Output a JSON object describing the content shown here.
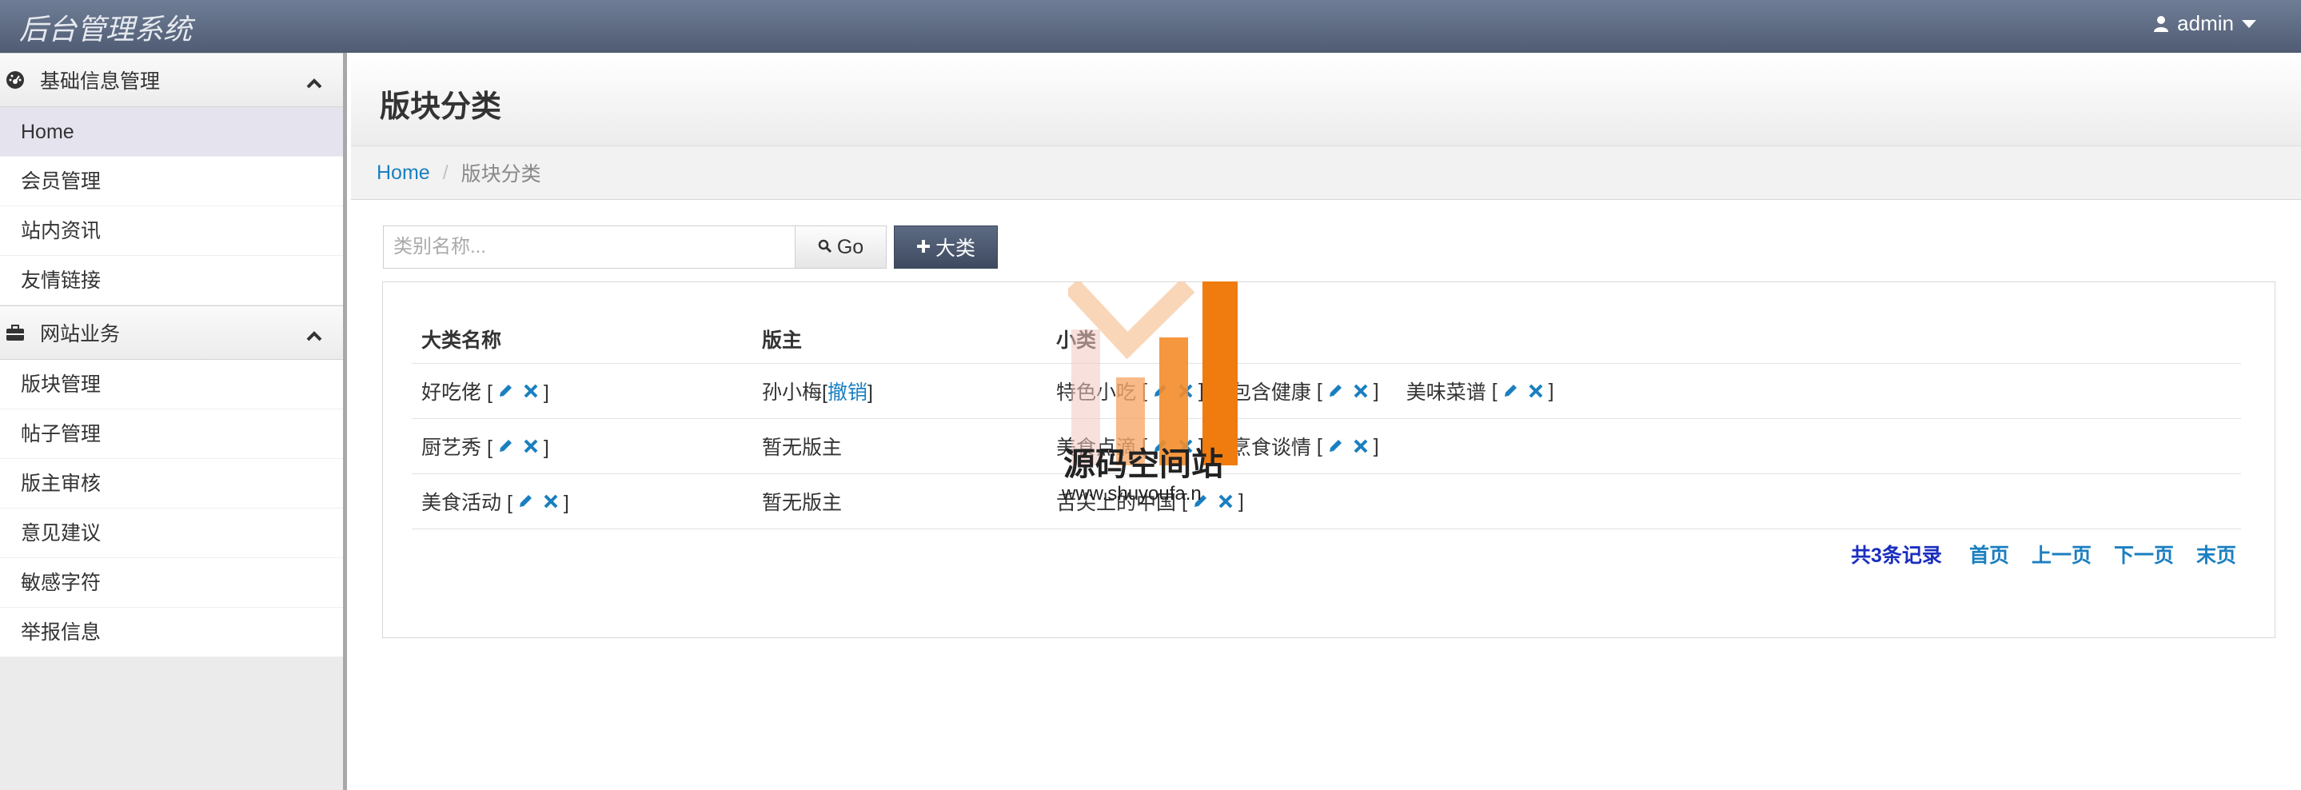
{
  "header": {
    "brand": "后台管理系统",
    "user": "admin"
  },
  "sidebar": {
    "groups": [
      {
        "title": "基础信息管理",
        "items": [
          {
            "label": "Home",
            "active": true
          },
          {
            "label": "会员管理"
          },
          {
            "label": "站内资讯"
          },
          {
            "label": "友情链接"
          }
        ]
      },
      {
        "title": "网站业务",
        "items": [
          {
            "label": "版块管理"
          },
          {
            "label": "帖子管理"
          },
          {
            "label": "版主审核"
          },
          {
            "label": "意见建议"
          },
          {
            "label": "敏感字符"
          },
          {
            "label": "举报信息"
          }
        ]
      }
    ]
  },
  "page": {
    "title": "版块分类",
    "breadcrumb": {
      "home": "Home",
      "current": "版块分类"
    }
  },
  "toolbar": {
    "search_placeholder": "类别名称...",
    "go_label": "Go",
    "add_label": "大类"
  },
  "table": {
    "headers": [
      "大类名称",
      "版主",
      "小类"
    ],
    "rows": [
      {
        "name": "好吃佬",
        "moderator": "孙小梅",
        "revoke": "撤销",
        "subs": [
          "特色小吃",
          "包含健康",
          "美味菜谱"
        ]
      },
      {
        "name": "厨艺秀",
        "moderator": "暂无版主",
        "subs": [
          "美食点滴",
          "烹食谈情"
        ]
      },
      {
        "name": "美食活动",
        "moderator": "暂无版主",
        "subs": [
          "舌尖上的中国"
        ]
      }
    ]
  },
  "pager": {
    "total": "共3条记录",
    "first": "首页",
    "prev": "上一页",
    "next": "下一页",
    "last": "末页"
  },
  "watermark": {
    "title": "源码空间站",
    "url": "www.shuyoufa.n"
  },
  "colors": {
    "topbar": "#5f6c84",
    "link": "#1a7fc0",
    "action_button": "#4a566c"
  }
}
